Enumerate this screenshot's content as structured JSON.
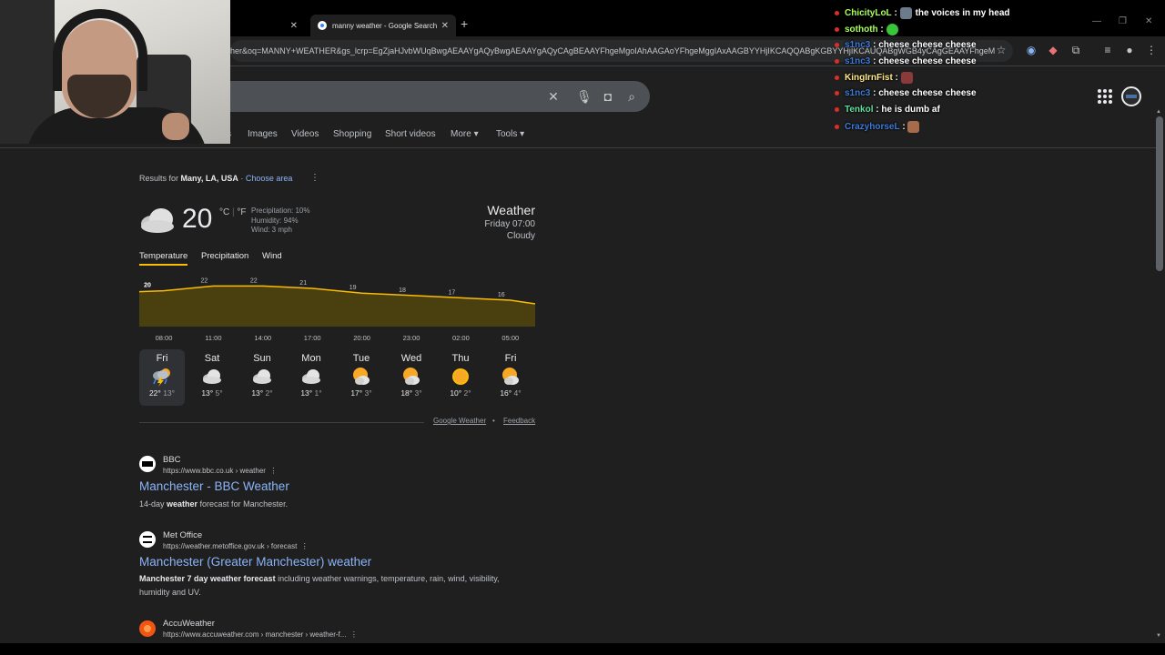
{
  "browser": {
    "tabs": [
      {
        "title": ""
      },
      {
        "title": "manny weather - Google Search"
      }
    ],
    "url": "her&oq=MANNY+WEATHER&gs_lcrp=EgZjaHJvbWUqBwgAEAAYgAQyBwgAEAAYgAQyCAgBEAAYFhgeMgoIAhAAGAoYFhgeMggIAxAAGBYYHjIKCAQQABgKGBYYHjIKCAUQABgWGB4yCAgGEAAYFhgeM"
  },
  "google": {
    "nav_tabs": [
      "s",
      "Images",
      "Videos",
      "Shopping",
      "Short videos",
      "More",
      "Tools"
    ]
  },
  "weather": {
    "results_prefix": "Results for",
    "location": "Many, LA, USA",
    "choose_area": "Choose area",
    "current_temp": "20",
    "unit_c": "°C",
    "unit_f": "°F",
    "precipitation": "Precipitation: 10%",
    "humidity": "Humidity: 94%",
    "wind": "Wind: 3 mph",
    "title": "Weather",
    "time": "Friday 07:00",
    "condition": "Cloudy",
    "tabs": [
      "Temperature",
      "Precipitation",
      "Wind"
    ],
    "chart_colors": {
      "fill": "#4a3f0e",
      "line": "#fbbc04"
    },
    "days": [
      {
        "name": "Fri",
        "hi": "22°",
        "lo": "13°",
        "icon": "thunderstorm-icon"
      },
      {
        "name": "Sat",
        "hi": "13°",
        "lo": "5°",
        "icon": "cloudy-icon"
      },
      {
        "name": "Sun",
        "hi": "13°",
        "lo": "2°",
        "icon": "cloudy-icon"
      },
      {
        "name": "Mon",
        "hi": "13°",
        "lo": "1°",
        "icon": "cloudy-icon"
      },
      {
        "name": "Tue",
        "hi": "17°",
        "lo": "3°",
        "icon": "partly-cloudy-icon"
      },
      {
        "name": "Wed",
        "hi": "18°",
        "lo": "3°",
        "icon": "partly-cloudy-icon"
      },
      {
        "name": "Thu",
        "hi": "10°",
        "lo": "2°",
        "icon": "sunny-icon"
      },
      {
        "name": "Fri",
        "hi": "16°",
        "lo": "4°",
        "icon": "partly-cloudy-icon"
      }
    ],
    "footer_source": "Google Weather",
    "footer_feedback": "Feedback"
  },
  "chart_data": {
    "type": "area",
    "x": [
      "08:00",
      "11:00",
      "14:00",
      "17:00",
      "20:00",
      "23:00",
      "02:00",
      "05:00"
    ],
    "values": [
      20,
      22,
      22,
      21,
      19,
      18,
      17,
      16
    ],
    "ylim": [
      0,
      30
    ]
  },
  "results": [
    {
      "source": "BBC",
      "url": "https://www.bbc.co.uk › weather",
      "title": "Manchester - BBC Weather",
      "snippet_pre": "14-day ",
      "snippet_bold": "weather",
      "snippet_post": " forecast for Manchester."
    },
    {
      "source": "Met Office",
      "url": "https://weather.metoffice.gov.uk › forecast",
      "title": "Manchester (Greater Manchester) weather",
      "snippet_pre": "",
      "snippet_bold": "Manchester 7 day weather forecast",
      "snippet_post": " including weather warnings, temperature, rain, wind, visibility, humidity and UV."
    },
    {
      "source": "AccuWeather",
      "url": "https://www.accuweather.com › manchester › weather-f...",
      "title": "",
      "snippet_pre": "",
      "snippet_bold": "",
      "snippet_post": ""
    }
  ],
  "chat": [
    {
      "user": "ChicityLoL",
      "color": "#a8ff5a",
      "msg": "the voices in my head",
      "emote": "#6b7b8c"
    },
    {
      "user": "sothoth",
      "color": "#a8ff5a",
      "msg": "",
      "emote": "#3ac43a"
    },
    {
      "user": "s1nc3",
      "color": "#3d7bd9",
      "msg": "cheese cheese cheese",
      "emote": ""
    },
    {
      "user": "s1nc3",
      "color": "#3d7bd9",
      "msg": "cheese cheese cheese",
      "emote": ""
    },
    {
      "user": "KingIrnFist",
      "color": "#ffe98a",
      "msg": "",
      "emote": "#8a3a3a"
    },
    {
      "user": "s1nc3",
      "color": "#3d7bd9",
      "msg": "cheese cheese cheese",
      "emote": ""
    },
    {
      "user": "Tenkol",
      "color": "#5fe0a0",
      "msg": "he is dumb af",
      "emote": ""
    },
    {
      "user": "CrazyhorseL",
      "color": "#3d7bd9",
      "msg": "",
      "emote": "#a56b4a"
    }
  ]
}
